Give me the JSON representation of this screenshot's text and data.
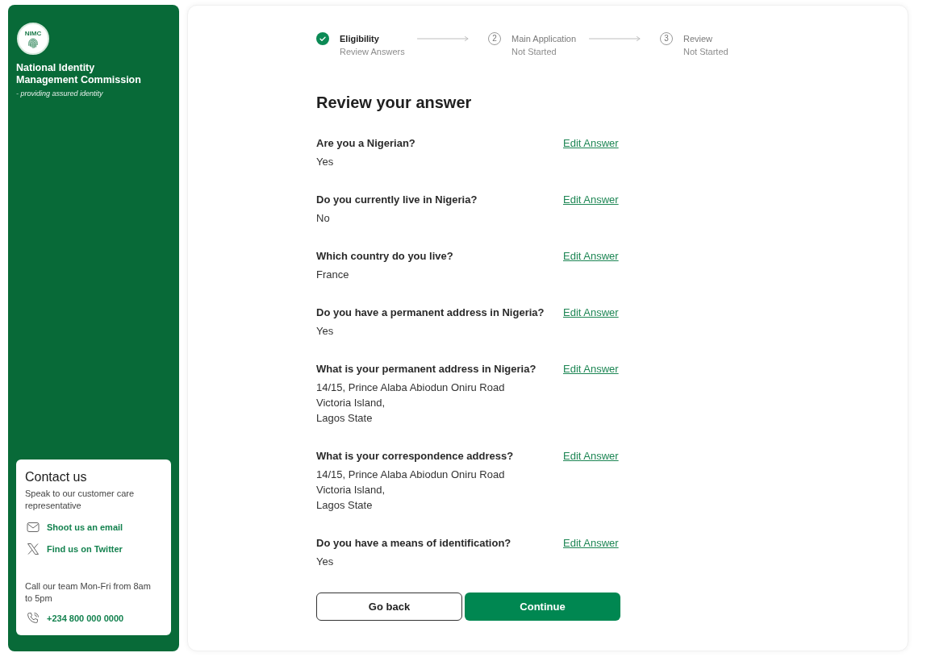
{
  "sidebar": {
    "logo_text": "NIMC",
    "org_name": "National Identity Management Commission",
    "tagline": "- providing assured identity",
    "contact": {
      "title": "Contact us",
      "description": "Speak to our customer care representative",
      "links": [
        {
          "kind": "email",
          "label": "Shoot us an email"
        },
        {
          "kind": "twitter",
          "label": "Find us on Twitter"
        }
      ],
      "hours": "Call our team Mon-Fri from 8am to 5pm",
      "phone": "+234 800 000 0000"
    }
  },
  "steps": [
    {
      "completed": true,
      "title": "Eligibility",
      "status": "Review Answers"
    },
    {
      "completed": false,
      "number": "2",
      "title": "Main Application",
      "status": "Not Started"
    },
    {
      "completed": false,
      "number": "3",
      "title": "Review",
      "status": "Not Started"
    }
  ],
  "heading": "Review your answer",
  "answers": [
    {
      "question": "Are you a Nigerian?",
      "answer": "Yes",
      "edit_label": "Edit Answer"
    },
    {
      "question": "Do you currently live in Nigeria?",
      "answer": "No",
      "edit_label": "Edit Answer"
    },
    {
      "question": "Which country do you live?",
      "answer": "France",
      "edit_label": "Edit Answer"
    },
    {
      "question": "Do you have a permanent address in Nigeria?",
      "answer": "Yes",
      "edit_label": "Edit Answer"
    },
    {
      "question": "What is your permanent address in Nigeria?",
      "answer": "14/15, Prince Alaba Abiodun Oniru Road\nVictoria Island,\nLagos State",
      "edit_label": "Edit Answer"
    },
    {
      "question": "What is your correspondence address?",
      "answer": "14/15, Prince Alaba Abiodun Oniru Road\nVictoria Island,\nLagos State",
      "edit_label": "Edit Answer"
    },
    {
      "question": "Do you have a means of identification?",
      "answer": "Yes",
      "edit_label": "Edit Answer"
    }
  ],
  "buttons": [
    {
      "kind": "secondary",
      "label": "Go back"
    },
    {
      "kind": "primary",
      "label": "Continue"
    }
  ]
}
